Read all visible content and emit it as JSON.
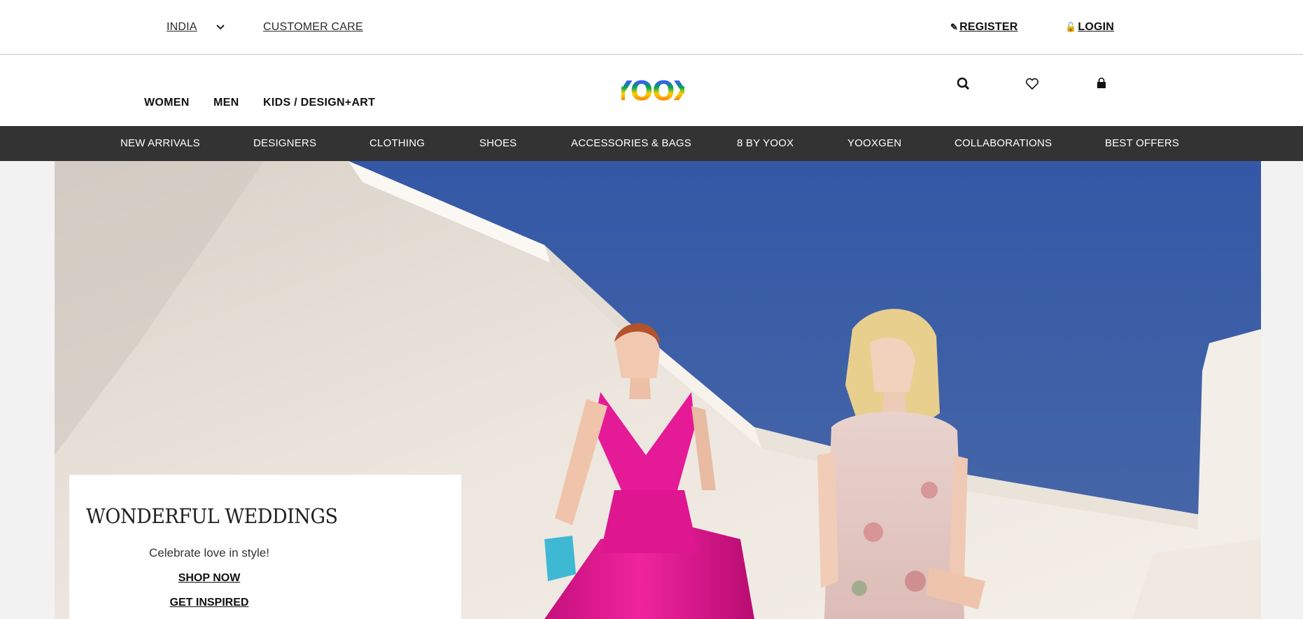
{
  "topbar": {
    "country": "INDIA",
    "customer_care": "CUSTOMER CARE",
    "register": "REGISTER",
    "login": "LOGIN"
  },
  "header": {
    "gender_nav": [
      "WOMEN",
      "MEN",
      "KIDS / DESIGN+ART"
    ],
    "logo": "YOOX",
    "icons": [
      "search-icon",
      "heart-icon",
      "shopping-bag-icon"
    ]
  },
  "categories": [
    "NEW ARRIVALS",
    "DESIGNERS",
    "CLOTHING",
    "SHOES",
    "ACCESSORIES & BAGS",
    "8 BY YOOX",
    "YOOXGEN",
    "COLLABORATIONS",
    "BEST OFFERS"
  ],
  "hero": {
    "title": "WONDERFUL WEDDINGS",
    "subtitle": "Celebrate love in style!",
    "cta_primary": "SHOP NOW",
    "cta_secondary": "GET INSPIRED"
  },
  "colors": {
    "nav_bar": "#333333",
    "sky": "#3d5e9e",
    "dress_pink": "#e0168f",
    "page_bg": "#f2f2f2"
  }
}
